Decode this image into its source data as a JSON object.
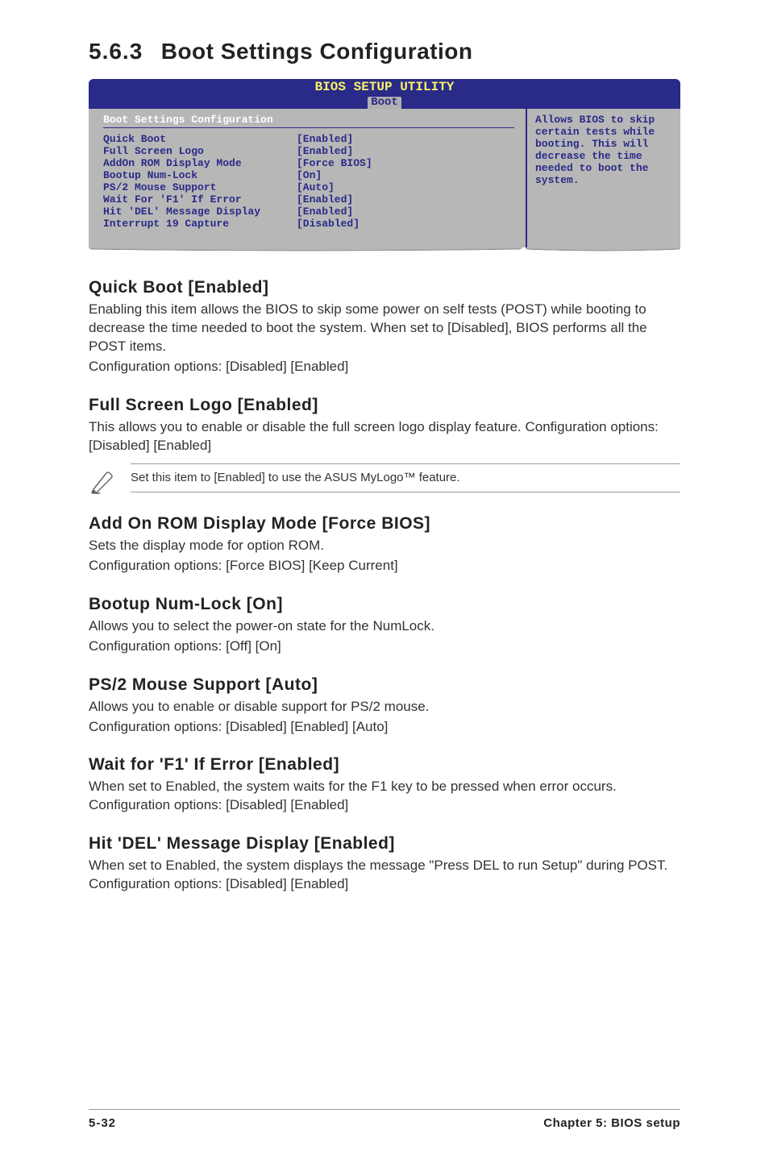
{
  "section": {
    "num": "5.6.3",
    "title": "Boot Settings Configuration"
  },
  "bios": {
    "header_line1": "BIOS SETUP UTILITY",
    "header_tab": "Boot",
    "left_title": "Boot Settings Configuration",
    "rows": [
      {
        "lbl": "Quick Boot",
        "val": "[Enabled]"
      },
      {
        "lbl": "Full Screen Logo",
        "val": "[Enabled]"
      },
      {
        "lbl": "AddOn ROM Display Mode",
        "val": "[Force BIOS]"
      },
      {
        "lbl": "Bootup Num-Lock",
        "val": "[On]"
      },
      {
        "lbl": "PS/2 Mouse Support",
        "val": "[Auto]"
      },
      {
        "lbl": "Wait For 'F1' If Error",
        "val": "[Enabled]"
      },
      {
        "lbl": "Hit 'DEL' Message Display",
        "val": "[Enabled]"
      },
      {
        "lbl": "Interrupt 19 Capture",
        "val": "[Disabled]"
      }
    ],
    "help": "Allows BIOS to skip certain tests while booting. This will decrease the time needed to boot the system."
  },
  "subs": {
    "quickboot": {
      "h": "Quick Boot [Enabled]",
      "p1": "Enabling this item allows the BIOS to skip some power on self tests (POST) while booting to decrease the time needed to boot the system. When set to [Disabled], BIOS performs all the POST items.",
      "p2": "Configuration options: [Disabled] [Enabled]"
    },
    "fslogo": {
      "h": "Full Screen Logo [Enabled]",
      "p1": "This allows you to enable or disable the full screen logo display feature. Configuration options: [Disabled] [Enabled]",
      "note": "Set this item to [Enabled] to use the ASUS MyLogo™ feature."
    },
    "addon": {
      "h": "Add On ROM Display Mode [Force BIOS]",
      "p1": "Sets the display mode for option ROM.",
      "p2": "Configuration options: [Force BIOS] [Keep Current]"
    },
    "numlock": {
      "h": "Bootup Num-Lock [On]",
      "p1": "Allows you to select the power-on state for the NumLock.",
      "p2": "Configuration options: [Off] [On]"
    },
    "ps2": {
      "h": "PS/2 Mouse Support [Auto]",
      "p1": "Allows you to enable or disable support for PS/2 mouse.",
      "p2": "Configuration options: [Disabled] [Enabled] [Auto]"
    },
    "waitf1": {
      "h": "Wait for 'F1' If Error [Enabled]",
      "p1": "When set to Enabled, the system waits for the F1 key to be pressed when error occurs. Configuration options: [Disabled] [Enabled]"
    },
    "hitdel": {
      "h": "Hit 'DEL' Message Display [Enabled]",
      "p1": "When set to Enabled, the system displays the message \"Press DEL to run Setup\" during POST. Configuration options: [Disabled] [Enabled]"
    }
  },
  "footer": {
    "page": "5-32",
    "chapter": "Chapter 5: BIOS setup"
  }
}
